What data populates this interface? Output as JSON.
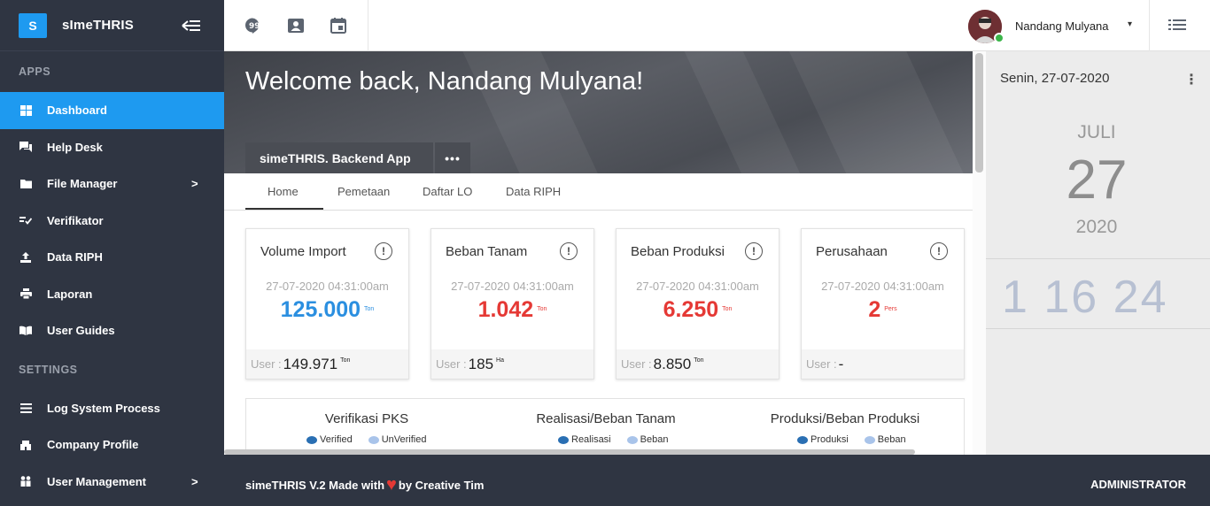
{
  "brand": {
    "logo_letter": "S",
    "name": "sImeTHRIS"
  },
  "sidebar": {
    "apps_title": "APPS",
    "settings_title": "SETTINGS",
    "items": [
      {
        "label": "Dashboard",
        "icon": "dashboard-icon",
        "active": true
      },
      {
        "label": "Help Desk",
        "icon": "chat-icon"
      },
      {
        "label": "File Manager",
        "icon": "folder-icon",
        "chevron": ">"
      },
      {
        "label": "Verifikator",
        "icon": "check-list-icon"
      },
      {
        "label": "Data RIPH",
        "icon": "upload-icon"
      },
      {
        "label": "Laporan",
        "icon": "printer-icon"
      },
      {
        "label": "User Guides",
        "icon": "book-icon"
      }
    ],
    "settings_items": [
      {
        "label": "Log System Process",
        "icon": "list-icon"
      },
      {
        "label": "Company Profile",
        "icon": "building-icon"
      },
      {
        "label": "User Management",
        "icon": "users-icon",
        "chevron": ">"
      }
    ]
  },
  "topbar": {
    "user_name": "Nandang Mulyana",
    "caret": "▾"
  },
  "hero": {
    "title": "Welcome back, Nandang Mulyana!",
    "tab_label": "simeTHRIS. Backend App",
    "more": "•••"
  },
  "tabs": [
    "Home",
    "Pemetaan",
    "Daftar LO",
    "Data RIPH"
  ],
  "cards": [
    {
      "title": "Volume Import",
      "date": "27-07-2020 04:31:00am",
      "value": "125.000",
      "unit": "Ton",
      "color": "#2b8fe0",
      "foot_label": "User :",
      "foot_value": "149.971",
      "foot_unit": "Ton"
    },
    {
      "title": "Beban Tanam",
      "date": "27-07-2020 04:31:00am",
      "value": "1.042",
      "unit": "Ton",
      "color": "#e53935",
      "foot_label": "User :",
      "foot_value": "185",
      "foot_unit": "Ha"
    },
    {
      "title": "Beban Produksi",
      "date": "27-07-2020 04:31:00am",
      "value": "6.250",
      "unit": "Ton",
      "color": "#e53935",
      "foot_label": "User :",
      "foot_value": "8.850",
      "foot_unit": "Ton"
    },
    {
      "title": "Perusahaan",
      "date": "27-07-2020 04:31:00am",
      "value": "2",
      "unit": "Pers",
      "color": "#e53935",
      "foot_label": "User :",
      "foot_value": "-",
      "foot_unit": ""
    }
  ],
  "charts": [
    {
      "title": "Verifikasi PKS",
      "legend": [
        {
          "label": "Verified",
          "color": "#2a6fb3"
        },
        {
          "label": "UnVerified",
          "color": "#a9c4ea"
        }
      ]
    },
    {
      "title": "Realisasi/Beban Tanam",
      "legend": [
        {
          "label": "Realisasi",
          "color": "#2a6fb3"
        },
        {
          "label": "Beban",
          "color": "#a9c4ea"
        }
      ]
    },
    {
      "title": "Produksi/Beban Produksi",
      "legend": [
        {
          "label": "Produksi",
          "color": "#2a6fb3"
        },
        {
          "label": "Beban",
          "color": "#a9c4ea"
        }
      ]
    }
  ],
  "right_panel": {
    "date": "Senin, 27-07-2020",
    "month": "JULI",
    "day": "27",
    "year": "2020",
    "clock": "1 16 24"
  },
  "footer": {
    "text_before": "simeTHRIS V.2 Made with",
    "text_after": "by Creative Tim",
    "role": "ADMINISTRATOR"
  },
  "colors": {
    "sidebar_bg": "#2f3542",
    "accent": "#1e9af0",
    "value_blue": "#2b8fe0",
    "value_red": "#e53935"
  }
}
